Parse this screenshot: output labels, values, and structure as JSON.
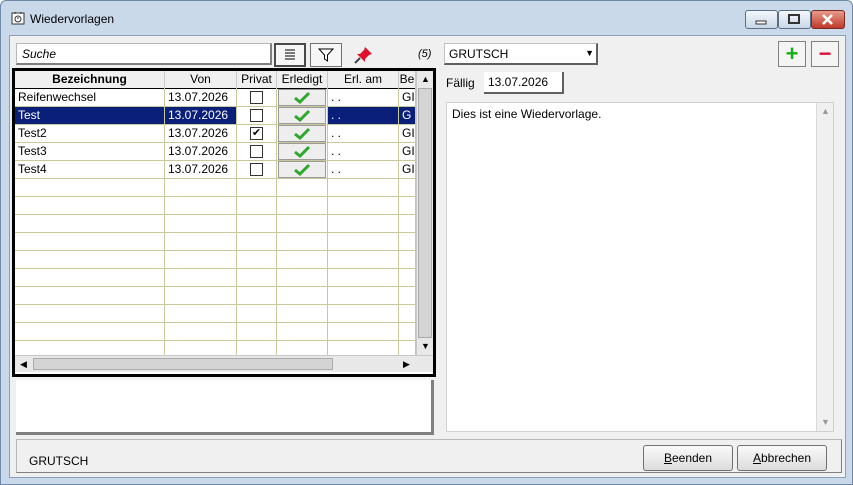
{
  "window": {
    "title": "Wiedervorlagen"
  },
  "toolbar": {
    "search_placeholder": "Suche",
    "count": "(5)"
  },
  "grid": {
    "columns": [
      "Bezeichnung",
      "Von",
      "Privat",
      "Erledigt",
      "Erl. am",
      "Be"
    ],
    "rows": [
      {
        "bezeichnung": "Reifenwechsel",
        "von": "13.07.2026",
        "privat": false,
        "erl_am": ". .",
        "be": "GI"
      },
      {
        "bezeichnung": "Test",
        "von": "13.07.2026",
        "privat": false,
        "erl_am": ". .",
        "be": "G"
      },
      {
        "bezeichnung": "Test2",
        "von": "13.07.2026",
        "privat": true,
        "erl_am": ". .",
        "be": "GI"
      },
      {
        "bezeichnung": "Test3",
        "von": "13.07.2026",
        "privat": false,
        "erl_am": ". .",
        "be": "GI"
      },
      {
        "bezeichnung": "Test4",
        "von": "13.07.2026",
        "privat": false,
        "erl_am": ". .",
        "be": "GI"
      }
    ],
    "selected_index": 1,
    "empty_rows": 10
  },
  "detail": {
    "user": "GRUTSCH",
    "faellig_label": "Fällig",
    "faellig_value": "13.07.2026",
    "memo": "Dies ist eine Wiedervorlage.",
    "add_icon": "+",
    "remove_icon": "−"
  },
  "footer": {
    "user": "GRUTSCH",
    "beenden_mnemonic": "B",
    "beenden_rest": "eenden",
    "abbrechen_mnemonic": "A",
    "abbrechen_rest": "bbrechen"
  },
  "colors": {
    "selected_row": "#0a1f7a",
    "check_green": "#2ea82e",
    "pin_red": "#e0102a",
    "add_green": "#12b012",
    "remove_red": "#e0103a"
  }
}
